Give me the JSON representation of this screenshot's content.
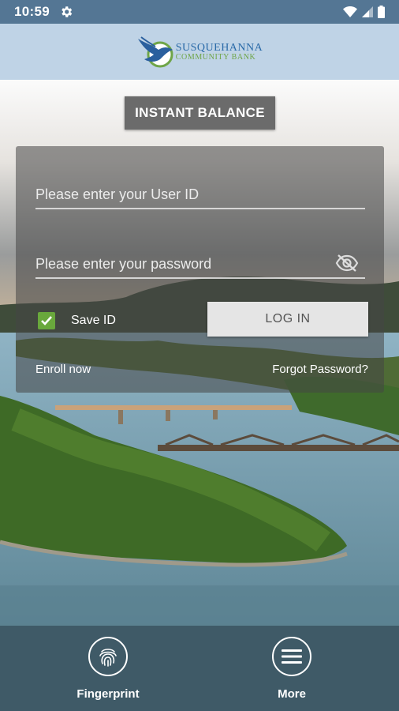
{
  "status_bar": {
    "time": "10:59"
  },
  "brand": {
    "name": "SUSQUEHANNA",
    "subtitle": "COMMUNITY BANK"
  },
  "instant_balance": {
    "label": "INSTANT BALANCE"
  },
  "login": {
    "user_placeholder": "Please enter your User ID",
    "password_placeholder": "Please enter your password",
    "save_id_label": "Save ID",
    "save_id_checked": true,
    "login_label": "LOG IN",
    "enroll_label": "Enroll now",
    "forgot_label": "Forgot Password?"
  },
  "bottom_nav": {
    "items": [
      {
        "label": "Fingerprint",
        "icon": "fingerprint-icon"
      },
      {
        "label": "More",
        "icon": "menu-icon"
      }
    ]
  },
  "colors": {
    "status_bar": "#547694",
    "brand_bar": "#bfd3e6",
    "accent_green": "#69a83c",
    "bottom_nav": "#3f5a67"
  }
}
